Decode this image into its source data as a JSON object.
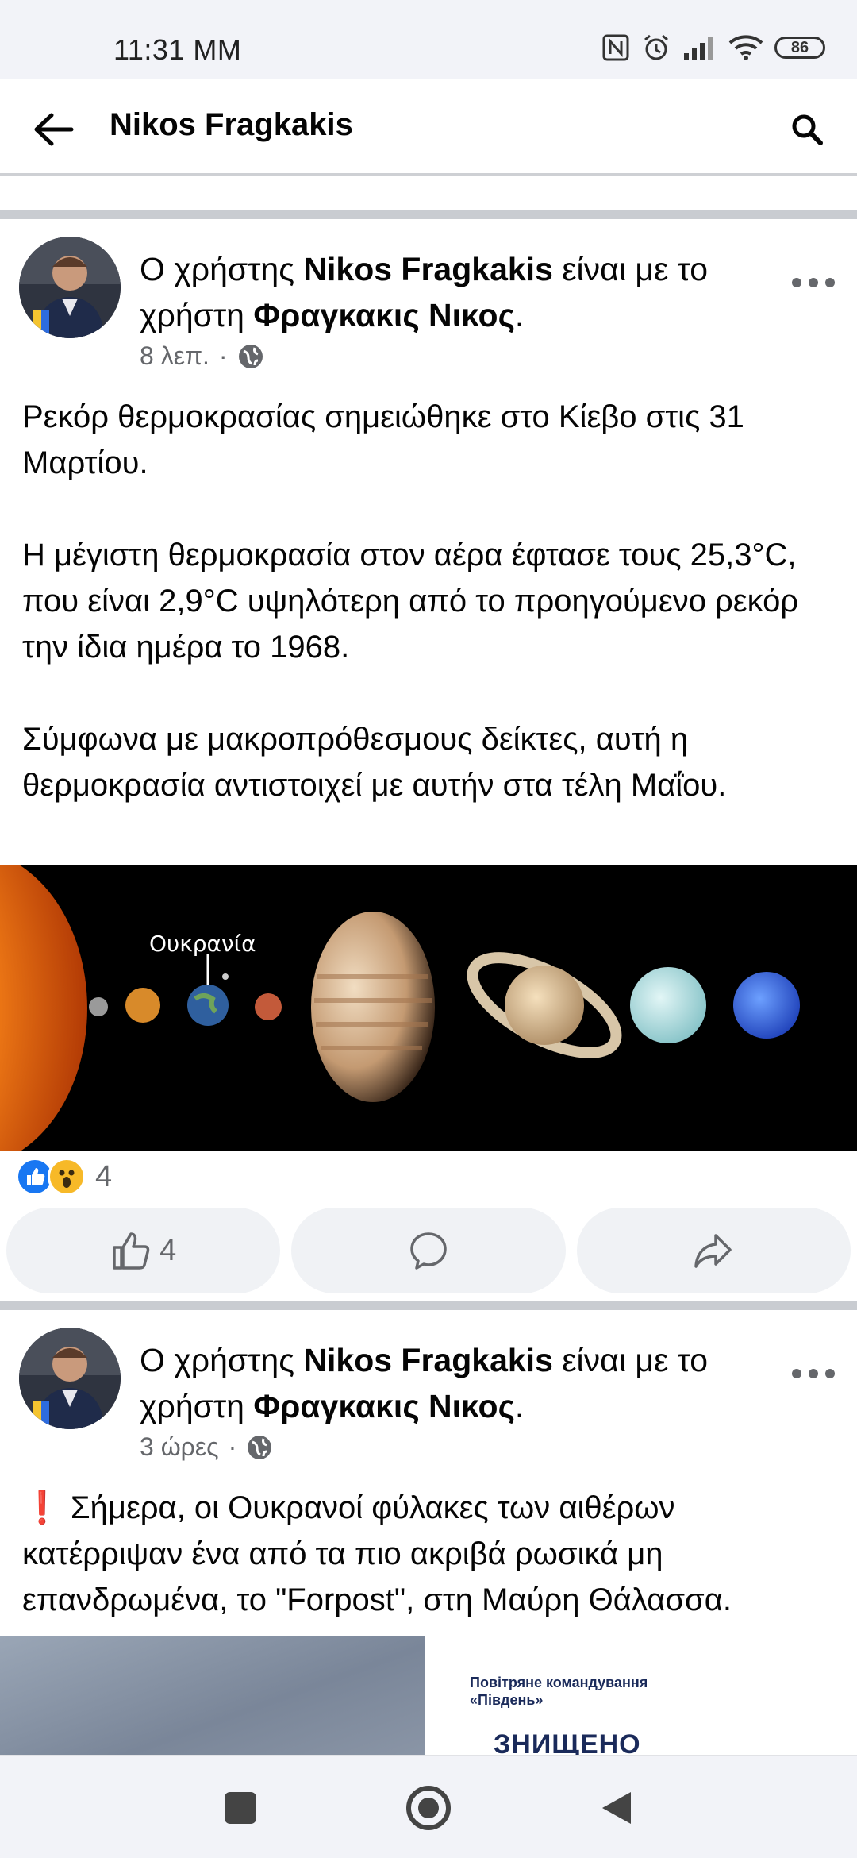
{
  "status": {
    "time": "11:31 ΜΜ",
    "battery": "86"
  },
  "header": {
    "title": "Nikos Fragkakis"
  },
  "posts": [
    {
      "prefix": "Ο χρήστης ",
      "author": "Nikos Fragkakis",
      "middle": " είναι με το χρήστη ",
      "tagged": "Φραγκακις Νικος",
      "suffix": ".",
      "time": "8 λεπ.",
      "text": "Ρεκόρ θερμοκρασίας σημειώθηκε στο Κίεβο στις 31 Μαρτίου.\n\nΗ μέγιστη θερμοκρασία στον αέρα έφτασε τους 25,3°C, που είναι 2,9°C υψηλότερη από το προηγούμενο ρεκόρ την ίδια ημέρα το 1968.\n\nΣύμφωνα με μακροπρόθεσμους δείκτες, αυτή η θερμοκρασία αντιστοιχεί με αυτήν στα τέλη Μαΐου.",
      "image_label": "Ουκρανία",
      "reaction_count": "4",
      "like_count": "4"
    },
    {
      "prefix": "Ο χρήστης ",
      "author": "Nikos Fragkakis",
      "middle": " είναι με το χρήστη ",
      "tagged": "Φραγκακις Νικος",
      "suffix": ".",
      "time": "3 ώρες",
      "text": "❗ Σήμερα, οι Ουκρανοί φύλακες των αιθέρων κατέρριψαν ένα από τα πιο ακριβά ρωσικά μη επανδρωμένα, το \"Forpost\", στη Μαύρη Θάλασσα.",
      "image_caption_1": "Повітряне командування «Південь»",
      "image_caption_2": "ЗНИЩЕНО"
    }
  ],
  "colors": {
    "fb_blue": "#1877f2",
    "muted": "#65676b",
    "divider": "#c9ccd1"
  },
  "icons": [
    "arrow-left-icon",
    "search-icon",
    "globe-icon",
    "like-icon",
    "wow-icon",
    "comment-icon",
    "share-icon"
  ]
}
